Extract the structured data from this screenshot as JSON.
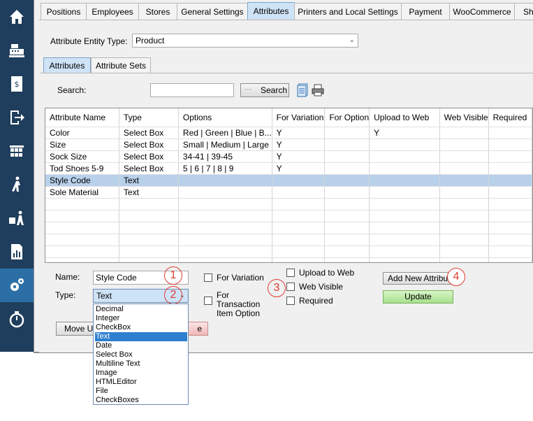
{
  "sidebar": {
    "icons": [
      "home-icon",
      "cash-register-icon",
      "invoice-icon",
      "logout-icon",
      "warehouse-icon",
      "walking-person-icon",
      "delivery-icon",
      "report-icon",
      "settings-gears-icon",
      "stopwatch-icon"
    ],
    "active_index": 8,
    "background": "#1f3d5c",
    "active_color": "#2c6fa6"
  },
  "tabs": [
    "Positions",
    "Employees",
    "Stores",
    "General Settings",
    "Attributes",
    "Printers and Local Settings",
    "Payment",
    "WooCommerce",
    "Sh"
  ],
  "selected_tab": "Attributes",
  "entity": {
    "label": "Attribute Entity Type:",
    "value": "Product"
  },
  "subtabs": [
    "Attributes",
    "Attribute Sets"
  ],
  "search": {
    "label": "Search:",
    "value": "",
    "button": "Search"
  },
  "grid": {
    "columns": [
      "Attribute Name",
      "Type",
      "Options",
      "For Variation",
      "For Option",
      "Upload to Web",
      "Web Visible",
      "Required"
    ],
    "rows": [
      [
        "Color",
        "Select Box",
        "Red | Green | Blue | B...",
        "Y",
        "",
        "Y",
        "",
        ""
      ],
      [
        "Size",
        "Select Box",
        "Small | Medium | Large",
        "Y",
        "",
        "",
        "",
        ""
      ],
      [
        "Sock Size",
        "Select Box",
        "34-41 | 39-45",
        "Y",
        "",
        "",
        "",
        ""
      ],
      [
        "Tod Shoes 5-9",
        "Select Box",
        "5 | 6 | 7 | 8 | 9",
        "Y",
        "",
        "",
        "",
        ""
      ],
      [
        "Style Code",
        "Text",
        "",
        "",
        "",
        "",
        "",
        ""
      ],
      [
        "Sole Material",
        "Text",
        "",
        "",
        "",
        "",
        "",
        ""
      ]
    ],
    "selected_row": 4,
    "selection_color": "#b8d0ea"
  },
  "form": {
    "name_label": "Name:",
    "name_value": "Style Code",
    "type_label": "Type:",
    "type_value": "Text",
    "for_variation": "For Variation",
    "for_transaction": "For Transaction Item Option",
    "upload_to_web": "Upload to Web",
    "web_visible": "Web Visible",
    "required": "Required",
    "add_button": "Add New Attribute",
    "update_button": "Update",
    "move_up": "Move Up",
    "delete_fragment": "e"
  },
  "type_options": [
    "Decimal",
    "Integer",
    "CheckBox",
    "Text",
    "Date",
    "Select Box",
    "Multiline Text",
    "Image",
    "HTMLEditor",
    "File",
    "CheckBoxes"
  ],
  "selected_type_index": 3,
  "callouts": [
    "1",
    "2",
    "3",
    "4"
  ],
  "callout_color": "#e03c32"
}
